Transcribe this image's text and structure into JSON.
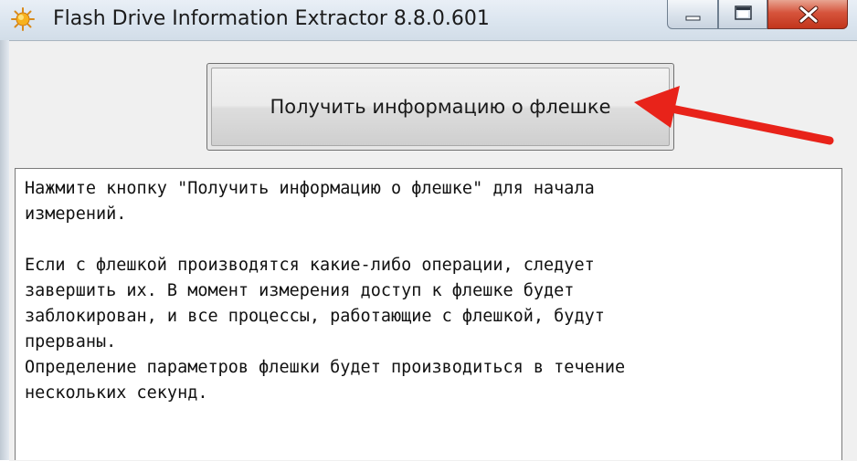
{
  "window": {
    "title": "Flash Drive Information Extractor 8.8.0.601",
    "icon": "sun-app-icon",
    "controls": {
      "minimize": "minimize-icon",
      "maximize": "maximize-icon",
      "close": "close-icon"
    }
  },
  "main": {
    "get_info_button_label": "Получить информацию о флешке",
    "log_lines": [
      "Нажмите кнопку \"Получить информацию о флешке\" для начала",
      "измерений.",
      "",
      "Если с флешкой производятся какие-либо операции, следует",
      "завершить их. В момент измерения доступ к флешке будет",
      "заблокирован, и все процессы, работающие с флешкой, будут",
      "прерваны.",
      "Определение параметров флешки будет производиться в течение",
      "нескольких секунд."
    ]
  },
  "annotation": {
    "arrow_color": "#e8231a",
    "icon": "red-arrow-icon"
  }
}
